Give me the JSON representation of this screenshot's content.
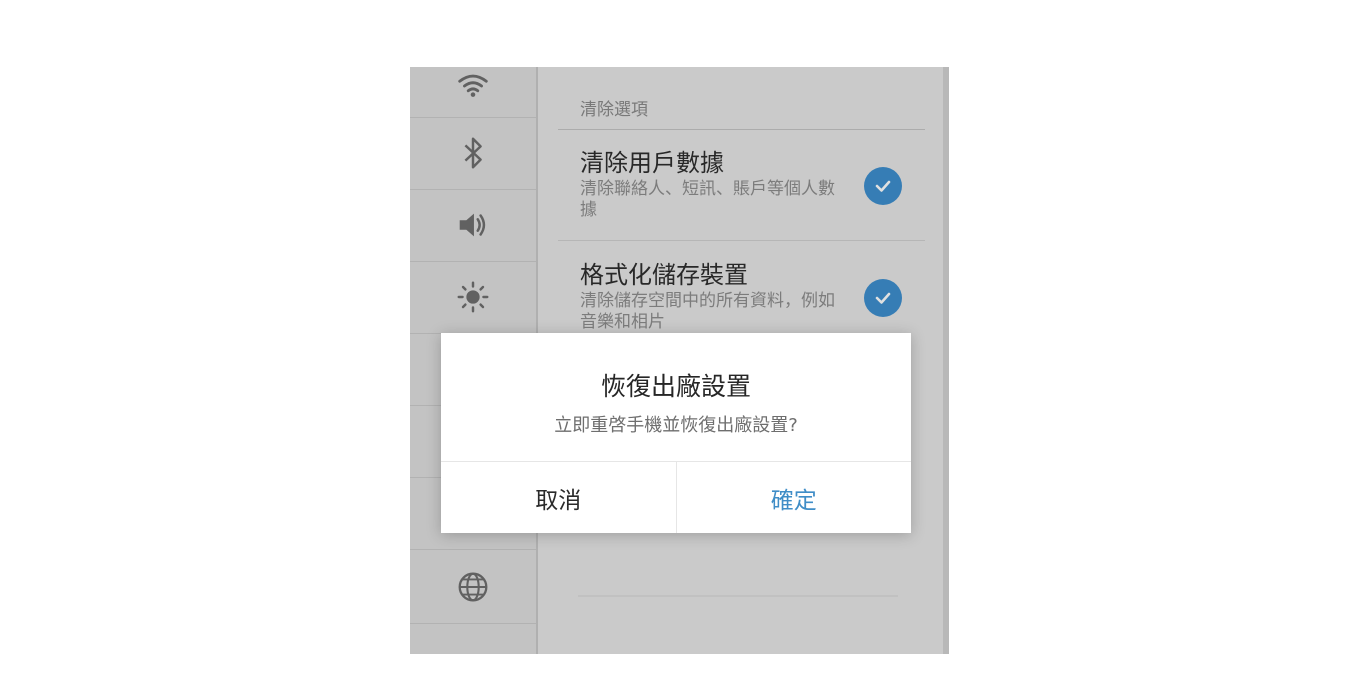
{
  "settings": {
    "section_title": "清除選項",
    "options": [
      {
        "title": "清除用戶數據",
        "desc": "清除聯絡人、短訊、賬戶等個人數據",
        "checked": true
      },
      {
        "title": "格式化儲存裝置",
        "desc": "清除儲存空間中的所有資料，例如音樂和相片",
        "checked": true
      }
    ]
  },
  "sidebar": {
    "icons": [
      "wifi-icon",
      "bluetooth-icon",
      "volume-icon",
      "brightness-icon",
      "globe-icon",
      "grid-icon"
    ]
  },
  "dialog": {
    "title": "恢復出廠設置",
    "message": "立即重啓手機並恢復出廠設置?",
    "cancel_label": "取消",
    "confirm_label": "確定"
  },
  "colors": {
    "accent": "#3f8dc7",
    "check_fill": "#3e8fcf"
  }
}
